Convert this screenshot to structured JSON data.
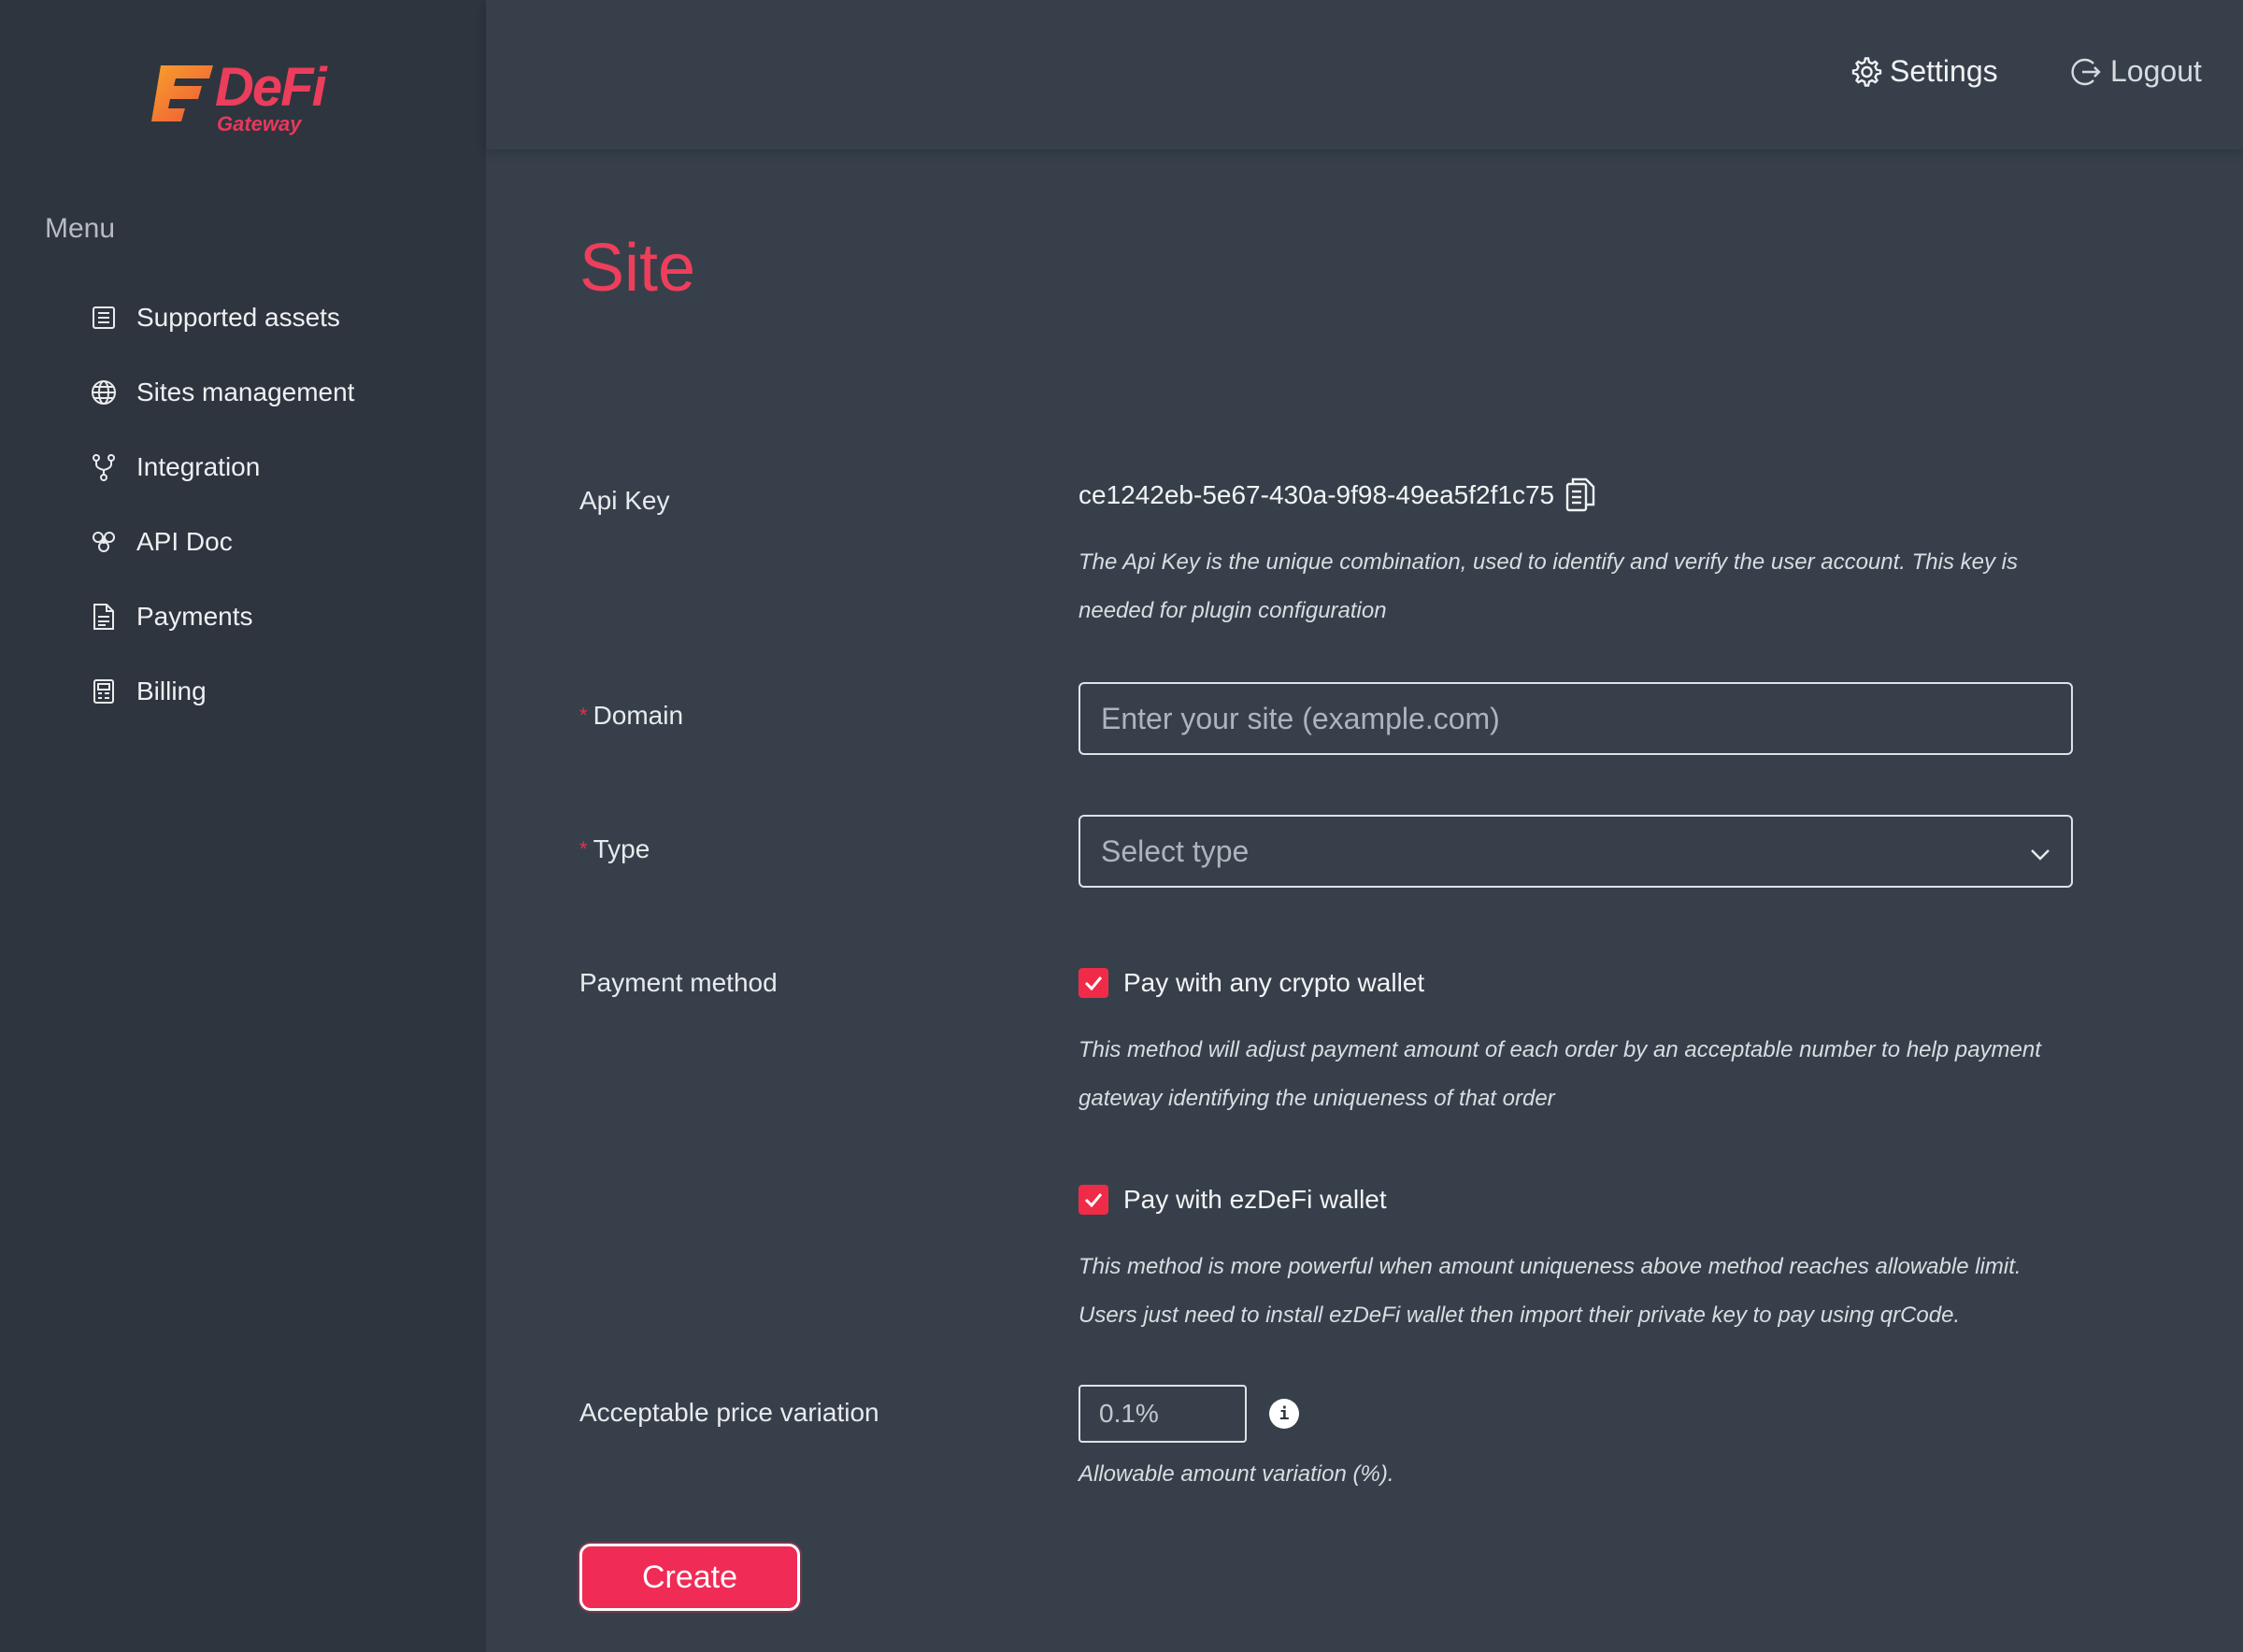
{
  "brand": {
    "logo_mark": "ez",
    "logo_name": "DeFi",
    "logo_sub": "Gateway"
  },
  "sidebar": {
    "heading": "Menu",
    "items": [
      {
        "label": "Supported assets",
        "icon": "list-icon"
      },
      {
        "label": "Sites management",
        "icon": "globe-icon"
      },
      {
        "label": "Integration",
        "icon": "fork-icon"
      },
      {
        "label": "API Doc",
        "icon": "api-icon"
      },
      {
        "label": "Payments",
        "icon": "document-icon"
      },
      {
        "label": "Billing",
        "icon": "receipt-icon"
      }
    ]
  },
  "header": {
    "settings_label": "Settings",
    "logout_label": "Logout"
  },
  "page": {
    "title": "Site"
  },
  "form": {
    "api_key": {
      "label": "Api Key",
      "value": "ce1242eb-5e67-430a-9f98-49ea5f2f1c75",
      "help": "The Api Key is the unique combination, used to identify and verify the user account. This key is needed for plugin configuration"
    },
    "domain": {
      "required_mark": "*",
      "label": "Domain",
      "value": "",
      "placeholder": "Enter your site (example.com)"
    },
    "type": {
      "required_mark": "*",
      "label": "Type",
      "placeholder": "Select type"
    },
    "payment_method": {
      "label": "Payment method",
      "options": [
        {
          "label": "Pay with any crypto wallet",
          "checked": true,
          "help": "This method will adjust payment amount of each order by an acceptable number to help payment gateway identifying the uniqueness of that order"
        },
        {
          "label": "Pay with ezDeFi wallet",
          "checked": true,
          "help": "This method is more powerful when amount uniqueness above method reaches allowable limit. Users just need to install ezDeFi wallet then import their private key to pay using qrCode."
        }
      ]
    },
    "price_variation": {
      "label": "Acceptable price variation",
      "value": "0.1%",
      "info_glyph": "i",
      "help": "Allowable amount variation (%)."
    },
    "submit_label": "Create"
  },
  "colors": {
    "accent": "#ef3e5c",
    "button": "#f02b56",
    "sidebar_bg": "#2e353e",
    "main_bg": "#37404a"
  }
}
